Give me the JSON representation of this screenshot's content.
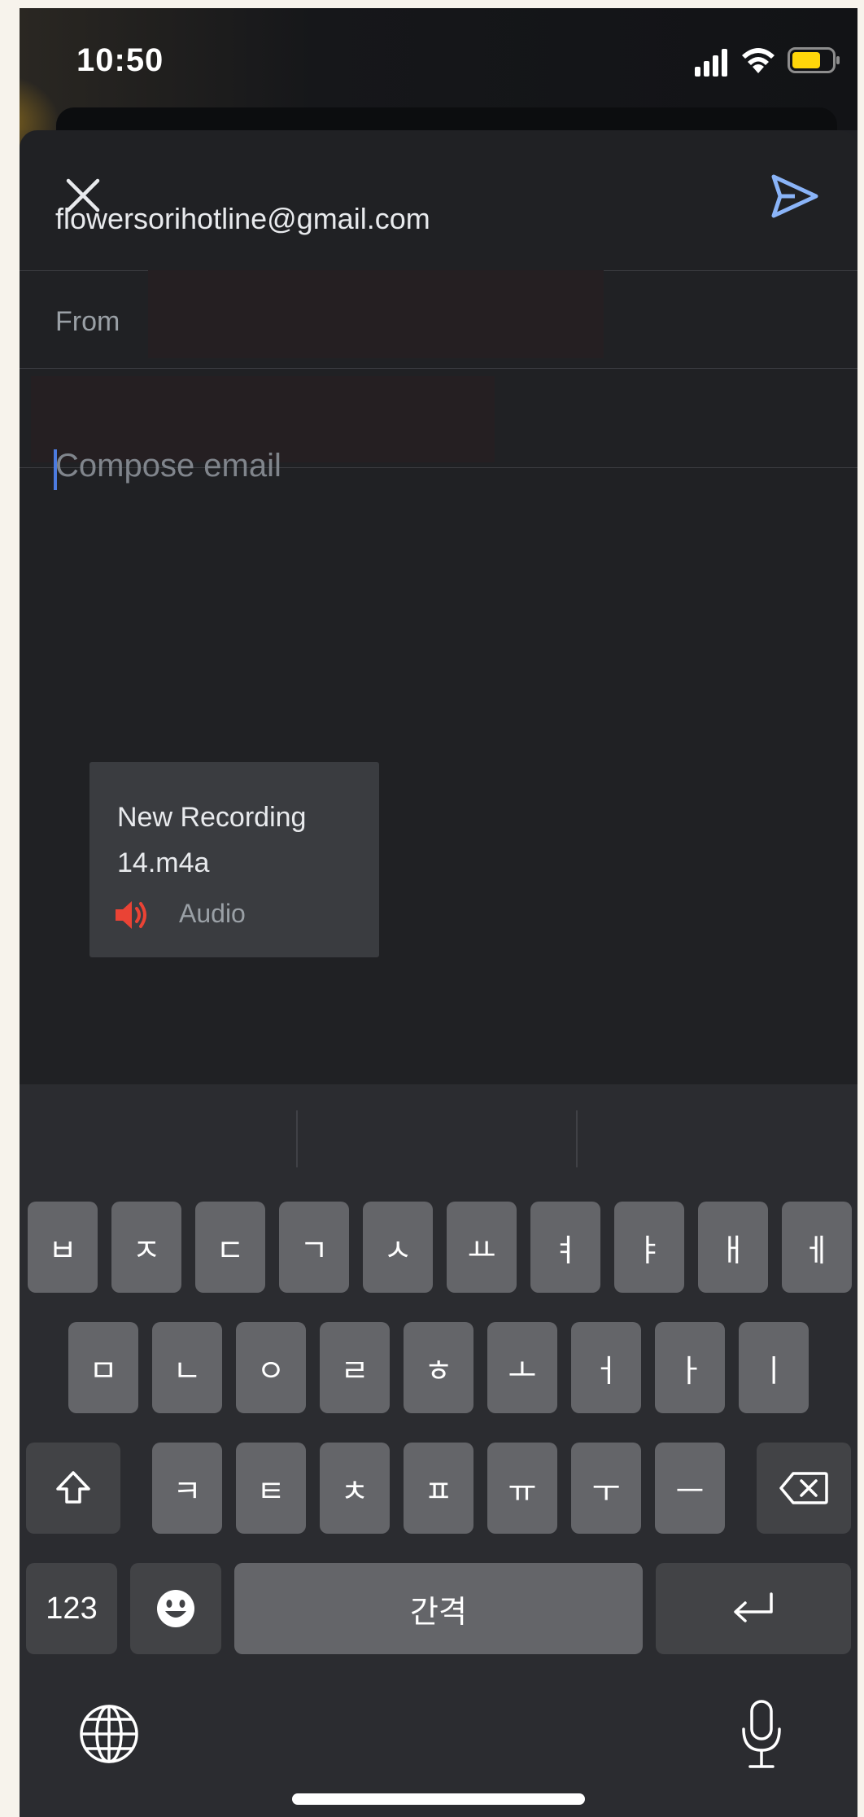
{
  "status_bar": {
    "time": "10:50",
    "icons": [
      "signal-icon",
      "wifi-icon",
      "battery-icon"
    ],
    "battery_color": "#ffd60a"
  },
  "compose": {
    "close_icon": "close-icon",
    "send_icon": "send-icon",
    "accent": "#8ab4f8",
    "to": "flowersorihotline@gmail.com",
    "from_label": "From",
    "body_placeholder": "Compose email",
    "attachment": {
      "name": "New Recording 14.m4a",
      "type_label": "Audio",
      "icon": "audio-icon",
      "icon_color": "#ea4335"
    }
  },
  "keyboard": {
    "row1": [
      "ㅂ",
      "ㅈ",
      "ㄷ",
      "ㄱ",
      "ㅅ",
      "ㅛ",
      "ㅕ",
      "ㅑ",
      "ㅐ",
      "ㅔ"
    ],
    "row2": [
      "ㅁ",
      "ㄴ",
      "ㅇ",
      "ㄹ",
      "ㅎ",
      "ㅗ",
      "ㅓ",
      "ㅏ",
      "ㅣ"
    ],
    "row3": [
      "ㅋ",
      "ㅌ",
      "ㅊ",
      "ㅍ",
      "ㅠ",
      "ㅜ",
      "ㅡ"
    ],
    "numbers_label": "123",
    "space_label": "간격",
    "shift_icon": "shift-icon",
    "backspace_icon": "backspace-icon",
    "emoji_icon": "emoji-icon",
    "return_icon": "return-icon",
    "globe_icon": "globe-icon",
    "mic_icon": "microphone-icon"
  }
}
